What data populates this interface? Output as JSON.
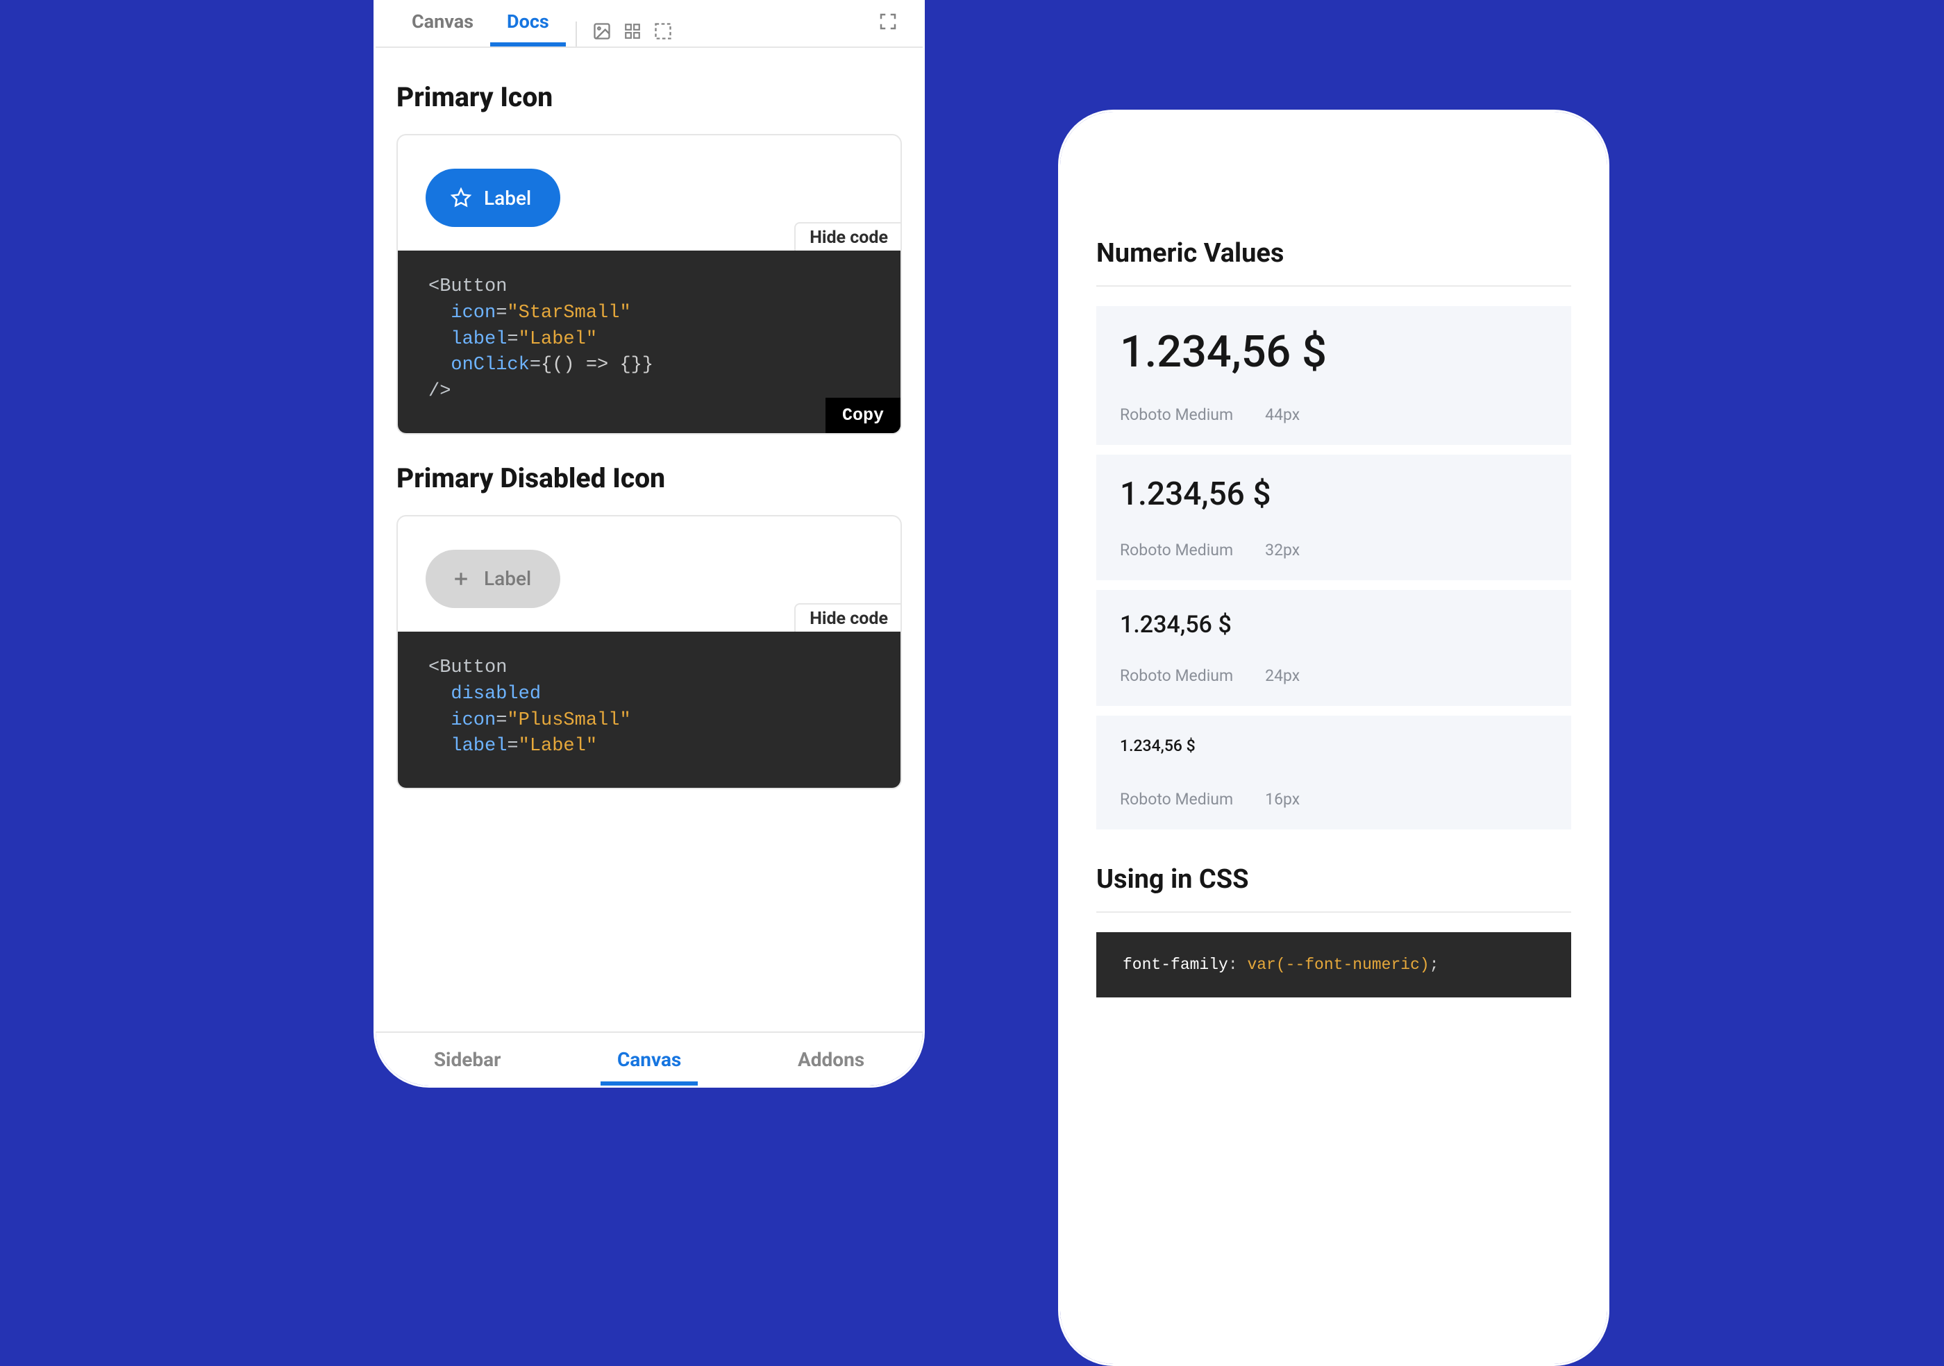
{
  "left": {
    "top_tabs": {
      "canvas": "Canvas",
      "docs": "Docs"
    },
    "section1": {
      "heading": "Primary Icon",
      "button_label": "Label",
      "hide_code": "Hide code",
      "copy": "Copy",
      "code": {
        "tag_open": "<Button",
        "attr_icon": "icon",
        "val_icon": "\"StarSmall\"",
        "attr_label": "label",
        "val_label": "\"Label\"",
        "attr_onclick": "onClick",
        "val_onclick": "{() => {}}",
        "close": "/>"
      }
    },
    "section2": {
      "heading": "Primary Disabled Icon",
      "button_label": "Label",
      "hide_code": "Hide code",
      "code": {
        "tag_open": "<Button",
        "attr_disabled": "disabled",
        "attr_icon": "icon",
        "val_icon": "\"PlusSmall\"",
        "attr_label": "label",
        "val_label": "\"Label\""
      }
    },
    "bottom_tabs": {
      "sidebar": "Sidebar",
      "canvas": "Canvas",
      "addons": "Addons"
    }
  },
  "right": {
    "title": "Numeric Values",
    "samples": [
      {
        "value": "1.234,56 $",
        "font": "Roboto Medium",
        "size": "44px"
      },
      {
        "value": "1.234,56 $",
        "font": "Roboto Medium",
        "size": "32px"
      },
      {
        "value": "1.234,56 $",
        "font": "Roboto Medium",
        "size": "24px"
      },
      {
        "value": "1.234,56 $",
        "font": "Roboto Medium",
        "size": "16px"
      }
    ],
    "css_heading": "Using in CSS",
    "css_code": {
      "prop": "font-family",
      "value": "var(--font-numeric)"
    }
  }
}
